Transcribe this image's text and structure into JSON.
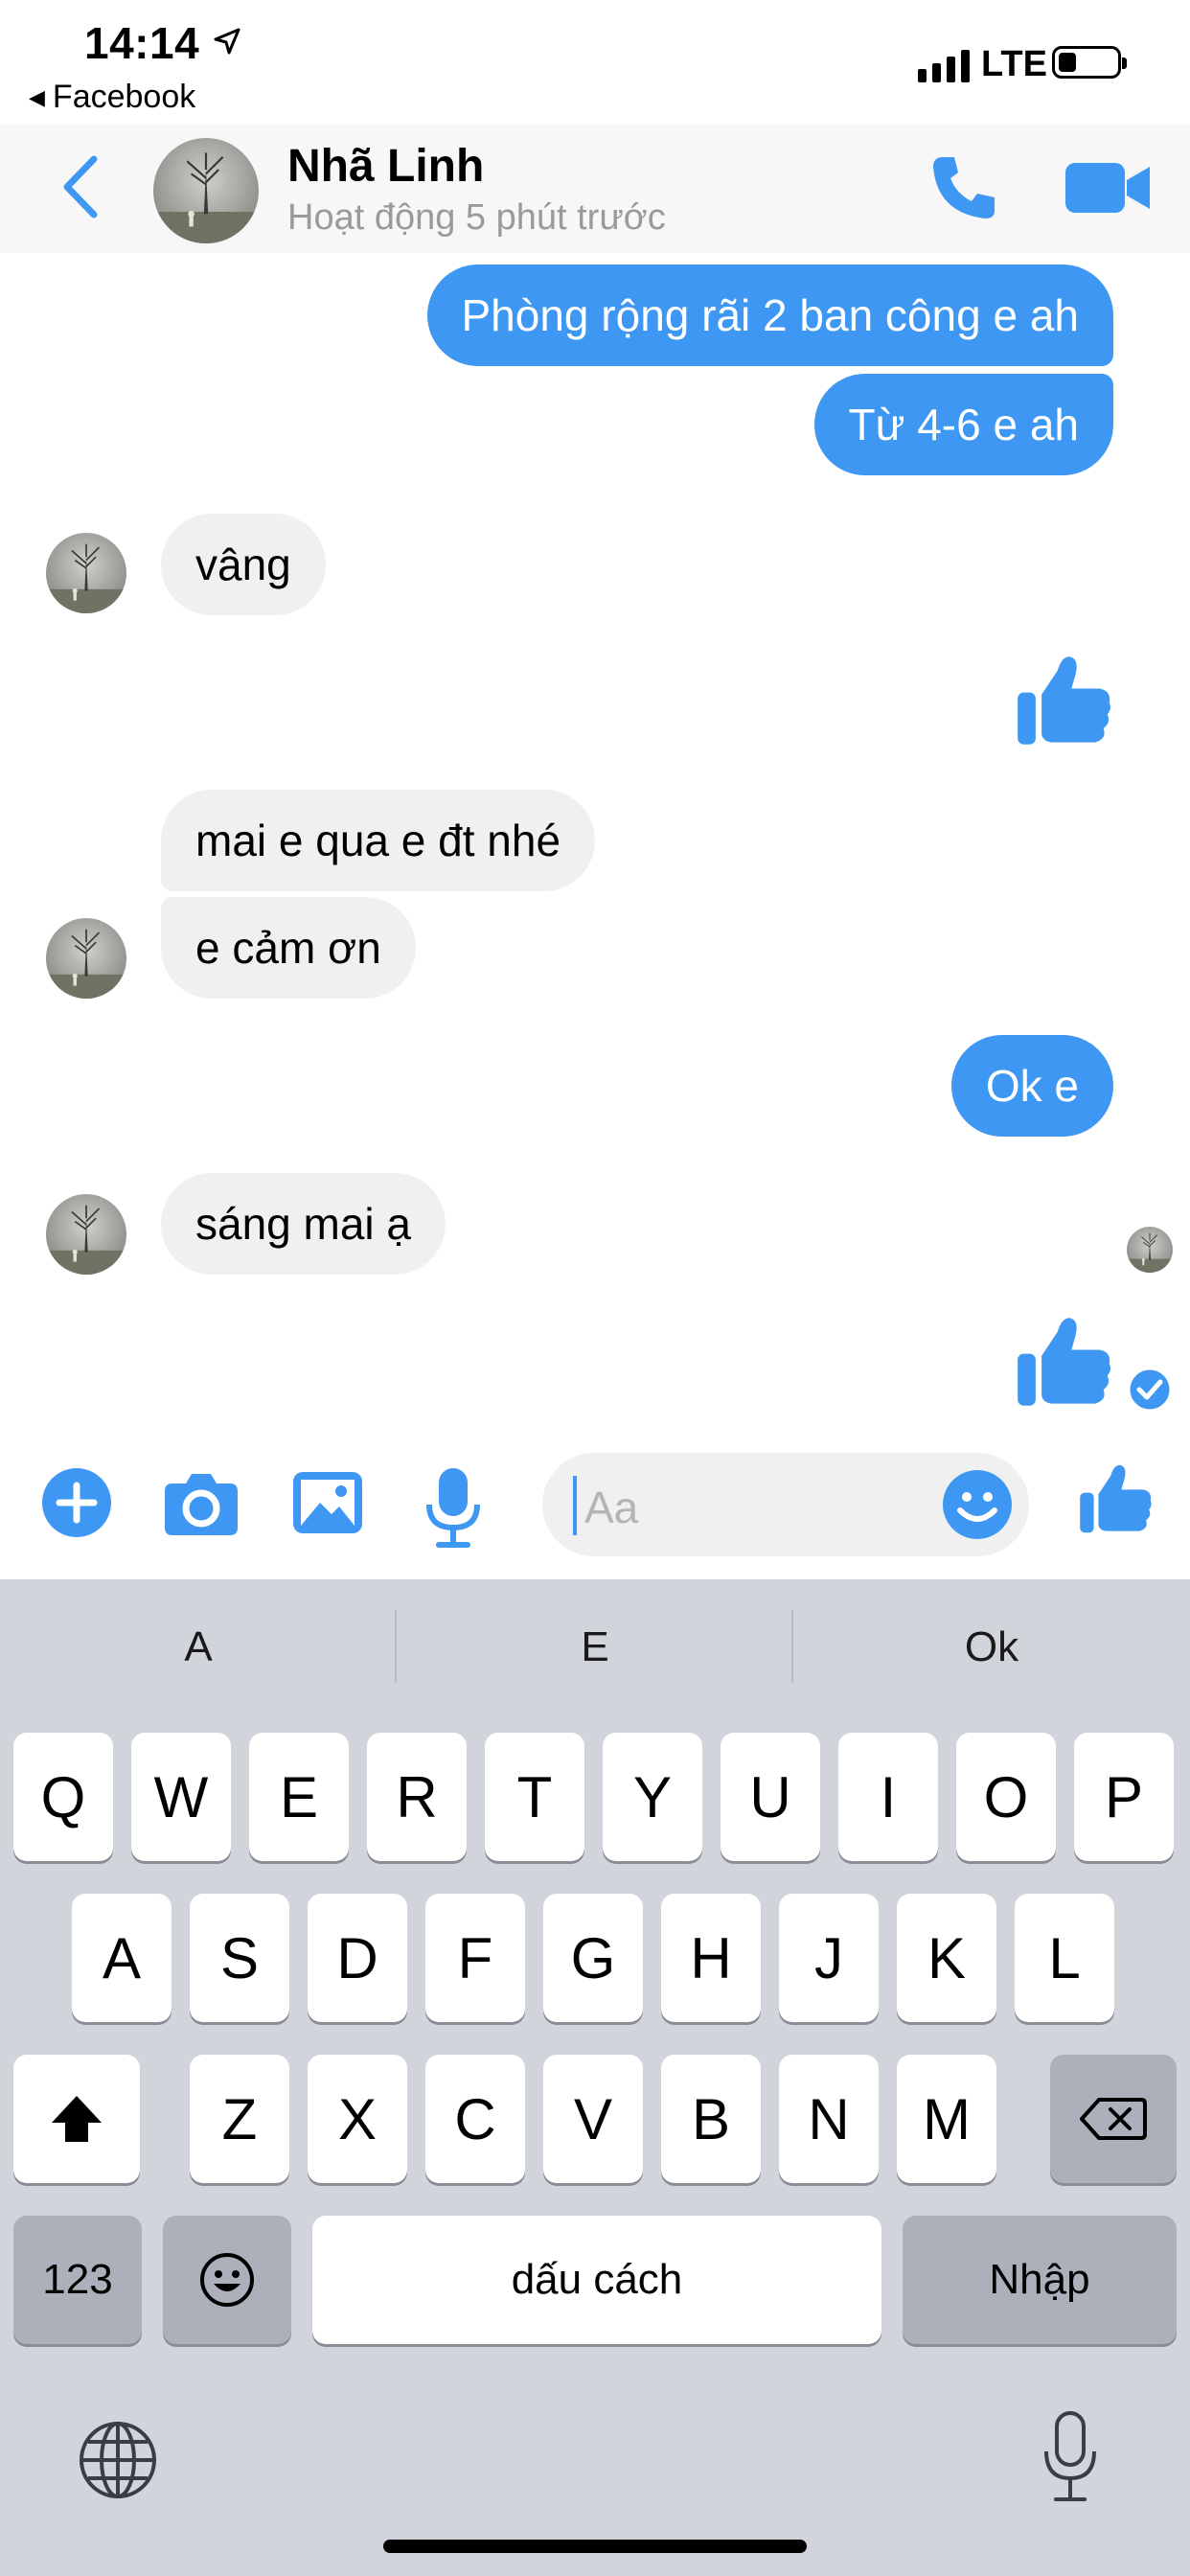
{
  "status_bar": {
    "time": "14:14",
    "back_app": "Facebook",
    "network": "LTE"
  },
  "header": {
    "name": "Nhã Linh",
    "status": "Hoạt động 5 phút trước"
  },
  "messages": [
    {
      "from": "me",
      "text": "Phòng rộng rãi 2 ban công e ah"
    },
    {
      "from": "me",
      "text": "Từ 4-6 e ah"
    },
    {
      "from": "them",
      "text": "vâng"
    },
    {
      "from": "them",
      "text": "mai e qua e đt nhé"
    },
    {
      "from": "them",
      "text": "e cảm ơn"
    },
    {
      "from": "me",
      "text": "Ok e"
    },
    {
      "from": "them",
      "text": "sáng mai ạ"
    }
  ],
  "composer": {
    "placeholder": "Aa"
  },
  "keyboard": {
    "suggestions": [
      "A",
      "E",
      "Ok"
    ],
    "row1": [
      "Q",
      "W",
      "E",
      "R",
      "T",
      "Y",
      "U",
      "I",
      "O",
      "P"
    ],
    "row2": [
      "A",
      "S",
      "D",
      "F",
      "G",
      "H",
      "J",
      "K",
      "L"
    ],
    "row3": [
      "Z",
      "X",
      "C",
      "V",
      "B",
      "N",
      "M"
    ],
    "numbers_label": "123",
    "space_label": "dấu cách",
    "return_label": "Nhập"
  },
  "colors": {
    "accent": "#3e97f2",
    "incoming_bubble": "#f0f0f0",
    "keyboard_bg": "#d1d4db"
  }
}
